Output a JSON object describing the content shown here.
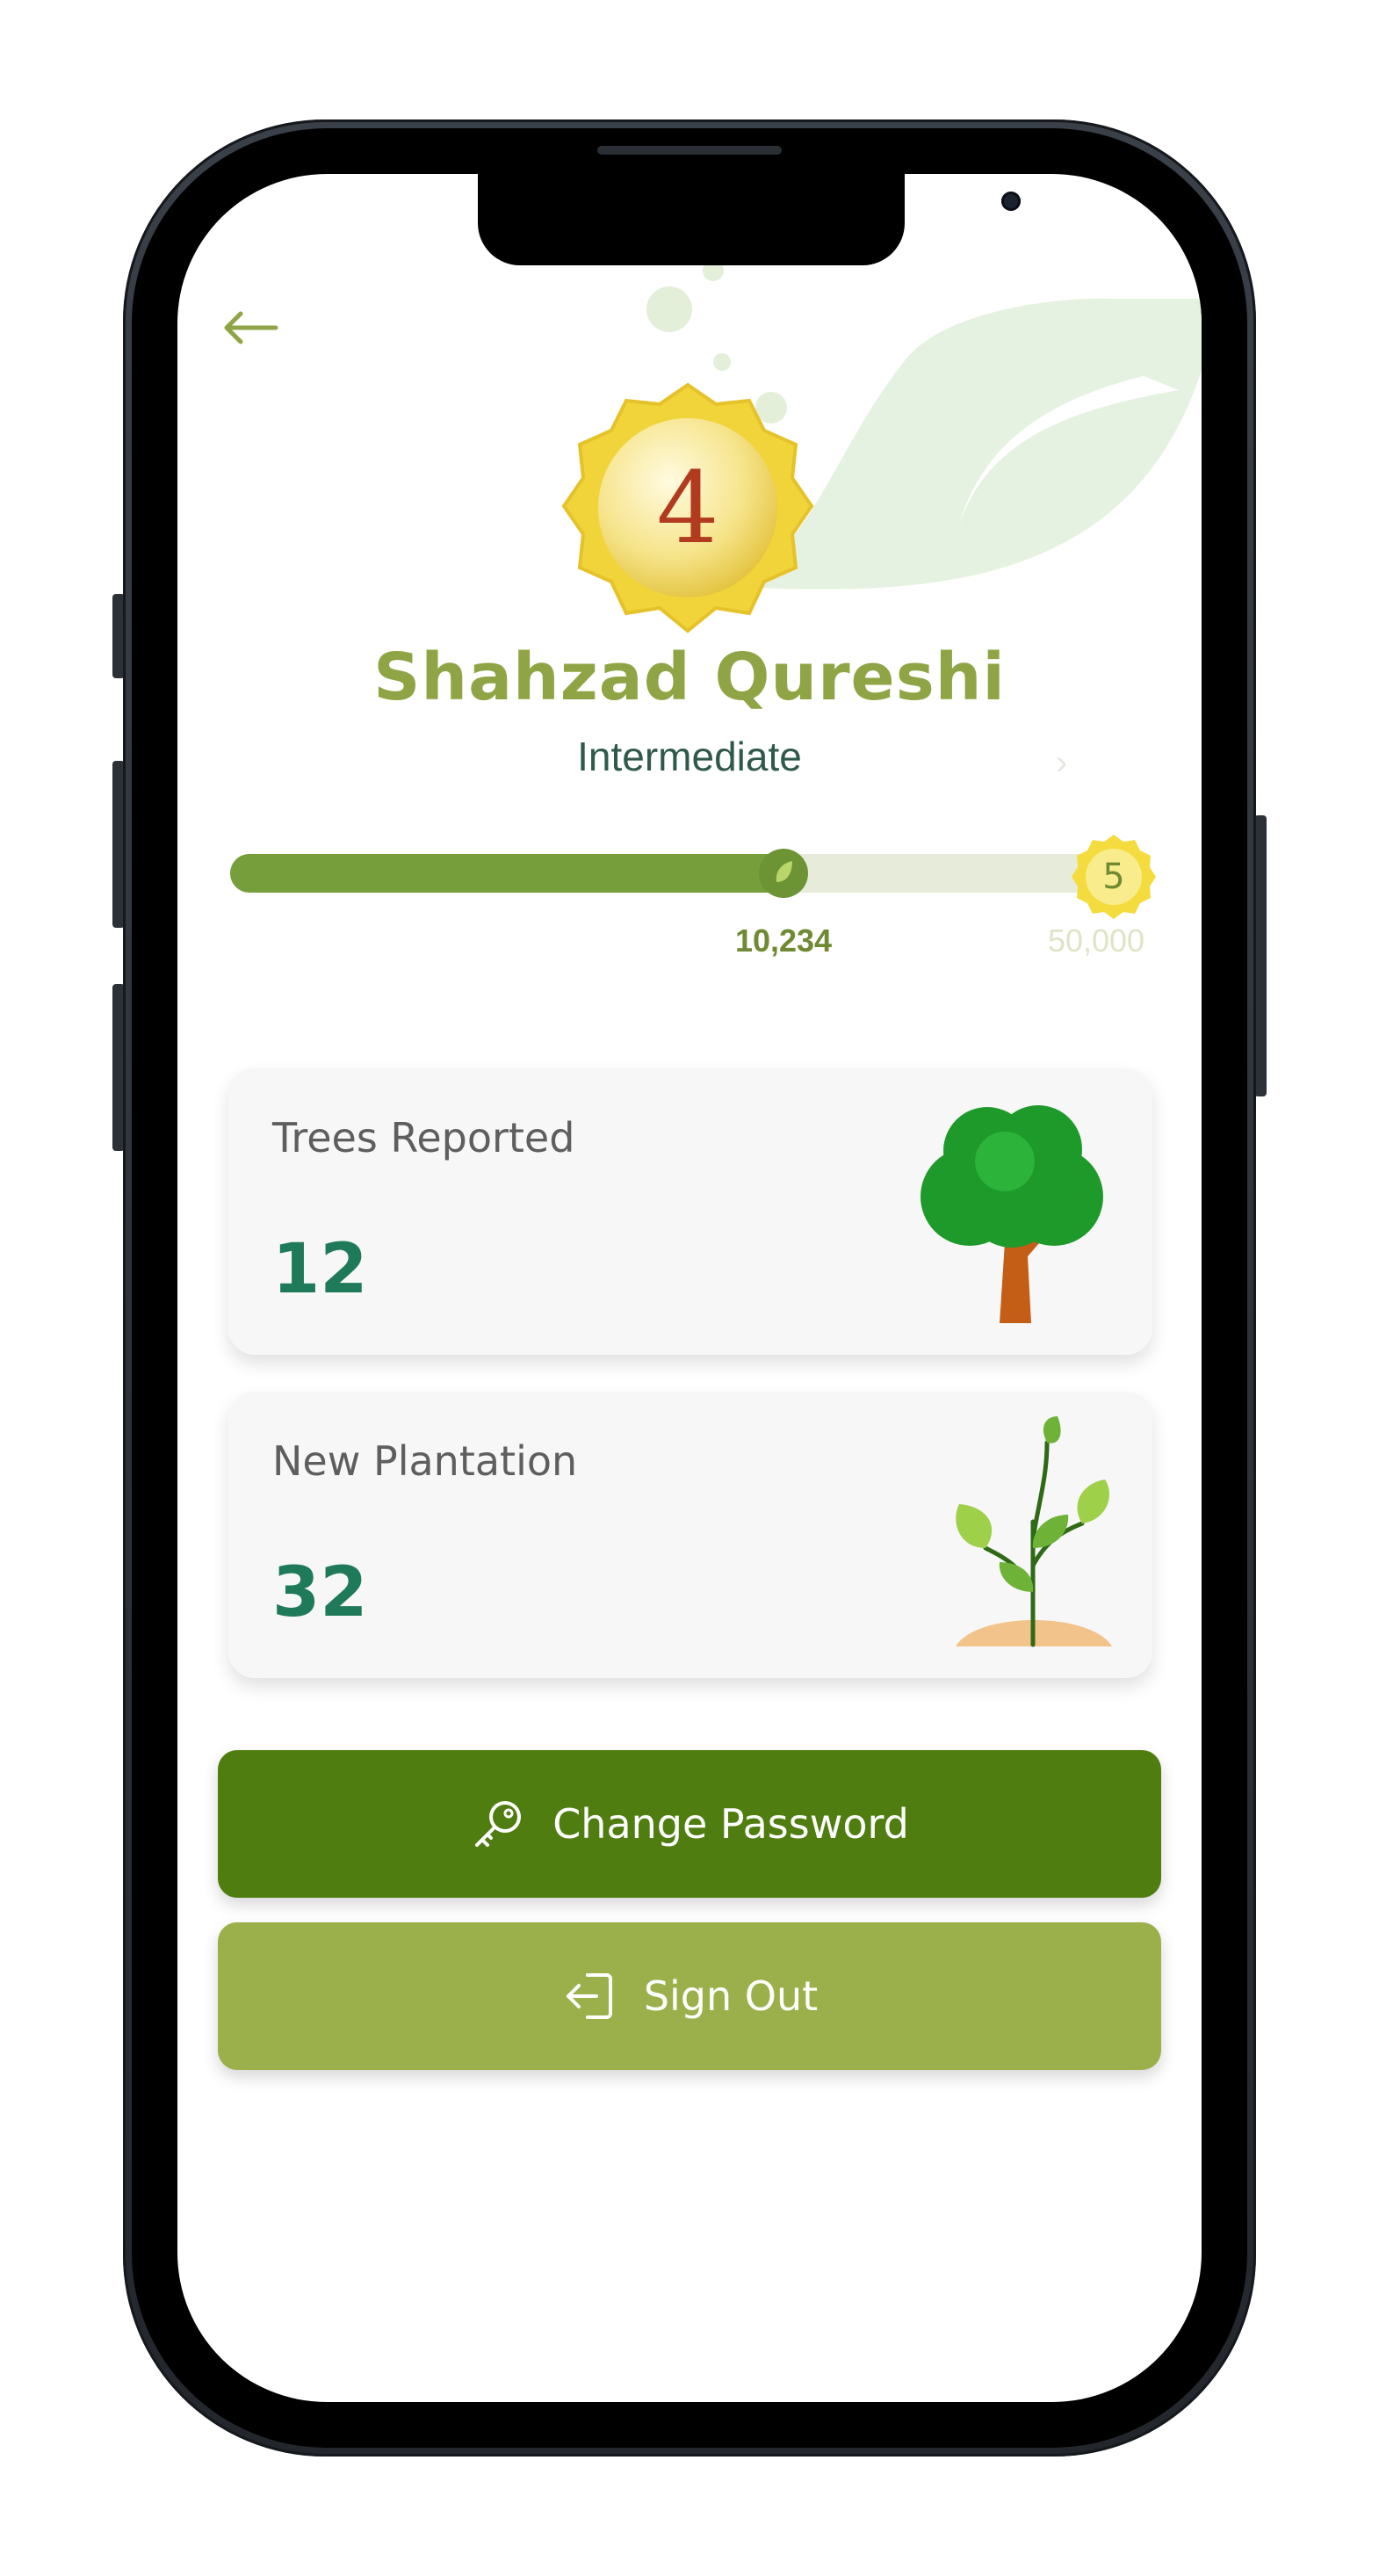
{
  "header": {
    "back_icon": "arrow-left-icon"
  },
  "profile": {
    "level": "4",
    "name": "Shahzad Qureshi",
    "rank": "Intermediate"
  },
  "progress": {
    "current_label": "10,234",
    "current_fraction": 0.63,
    "next_level": "5",
    "max_label": "50,000"
  },
  "stats": [
    {
      "title": "Trees Reported",
      "value": "12",
      "icon": "tree-icon"
    },
    {
      "title": "New Plantation",
      "value": "32",
      "icon": "sapling-icon"
    }
  ],
  "actions": {
    "change_password": "Change Password",
    "sign_out": "Sign Out"
  },
  "colors": {
    "primary": "#507d10",
    "secondary": "#9bb04b",
    "name": "#8fa545",
    "value": "#1f7a5a"
  }
}
